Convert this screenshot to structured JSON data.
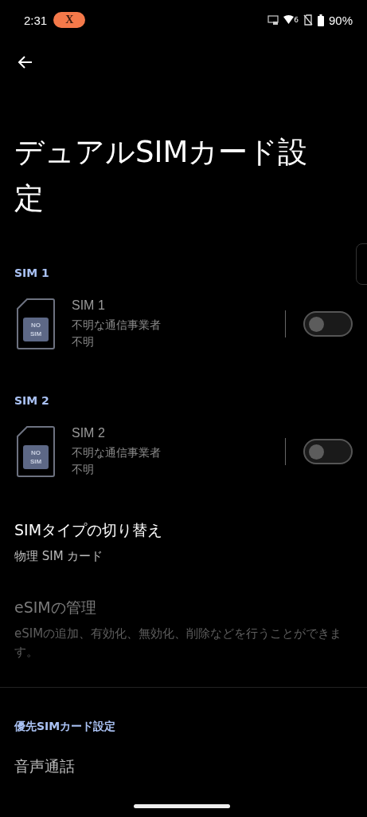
{
  "status_bar": {
    "time": "2:31",
    "app_pill": "X",
    "wifi_badge": "6",
    "battery": "90%"
  },
  "title": "デュアルSIMカード設定",
  "sim_sections": [
    {
      "header": "SIM 1",
      "icon_label_1": "NO",
      "icon_label_2": "SIM",
      "name": "SIM 1",
      "carrier": "不明な通信事業者",
      "number": "不明",
      "on": false
    },
    {
      "header": "SIM 2",
      "icon_label_1": "NO",
      "icon_label_2": "SIM",
      "name": "SIM 2",
      "carrier": "不明な通信事業者",
      "number": "不明",
      "on": false
    }
  ],
  "settings": [
    {
      "title": "SIMタイプの切り替え",
      "summary": "物理 SIM カード",
      "disabled": false
    },
    {
      "title": "eSIMの管理",
      "summary": "eSIMの追加、有効化、無効化、削除などを行うことができます。",
      "disabled": true
    }
  ],
  "preferred_header": "優先SIMカード設定",
  "preferred_items": [
    {
      "title": "音声通話"
    }
  ]
}
